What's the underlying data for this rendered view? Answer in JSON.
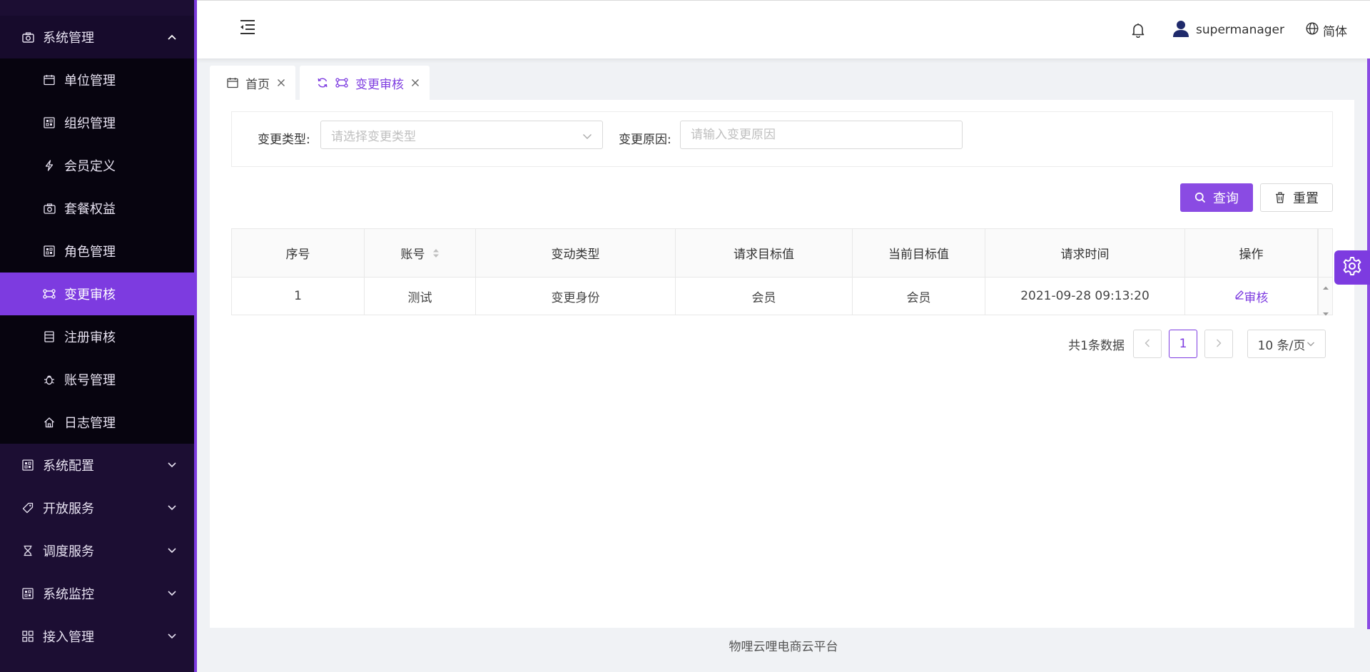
{
  "sidebar": {
    "system_mgmt": {
      "label": "系统管理",
      "icon": "camera-icon"
    },
    "sub_items": [
      {
        "label": "单位管理",
        "icon": "calendar-icon"
      },
      {
        "label": "组织管理",
        "icon": "grid-icon"
      },
      {
        "label": "会员定义",
        "icon": "lightning-icon"
      },
      {
        "label": "套餐权益",
        "icon": "camera-icon"
      },
      {
        "label": "角色管理",
        "icon": "grid-icon"
      },
      {
        "label": "变更审核",
        "icon": "swap-icon",
        "active": true
      },
      {
        "label": "注册审核",
        "icon": "list-icon"
      },
      {
        "label": "账号管理",
        "icon": "bug-icon"
      },
      {
        "label": "日志管理",
        "icon": "home-icon"
      }
    ],
    "groups": [
      {
        "label": "系统配置",
        "icon": "grid-icon"
      },
      {
        "label": "开放服务",
        "icon": "tag-icon"
      },
      {
        "label": "调度服务",
        "icon": "hourglass-icon"
      },
      {
        "label": "系统监控",
        "icon": "grid-icon"
      },
      {
        "label": "接入管理",
        "icon": "apps-icon"
      }
    ]
  },
  "header": {
    "username": "supermanager",
    "language": "简体"
  },
  "tabs": [
    {
      "label": "首页",
      "active": false
    },
    {
      "label": "变更审核",
      "active": true
    }
  ],
  "filters": {
    "change_type_label": "变更类型:",
    "change_type_placeholder": "请选择变更类型",
    "change_reason_label": "变更原因:",
    "change_reason_placeholder": "请输入变更原因"
  },
  "buttons": {
    "query": "查询",
    "reset": "重置"
  },
  "table": {
    "columns": [
      "序号",
      "账号",
      "变动类型",
      "请求目标值",
      "当前目标值",
      "请求时间",
      "操作"
    ],
    "rows": [
      {
        "index": "1",
        "account": "测试",
        "change_type": "变更身份",
        "requested_value": "会员",
        "current_value": "会员",
        "request_time": "2021-09-28 09:13:20",
        "action": "审核"
      }
    ]
  },
  "pagination": {
    "total_text": "共1条数据",
    "current_page": "1",
    "page_size": "10 条/页"
  },
  "footer": {
    "text": "物哩云哩电商云平台"
  },
  "colors": {
    "accent": "#7d3be0",
    "sidebar_bg": "#1c0e33",
    "submenu_bg": "#07040f"
  }
}
